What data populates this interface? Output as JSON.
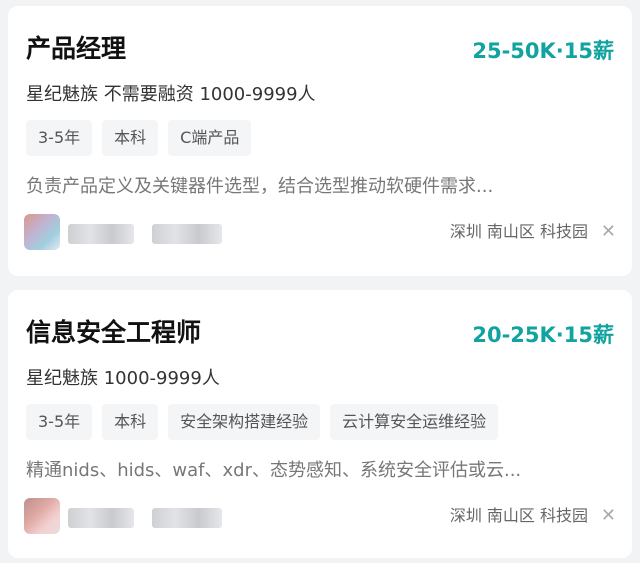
{
  "jobs": [
    {
      "title": "产品经理",
      "salary": "25-50K·15薪",
      "company": "星纪魅族 不需要融资 1000-9999人",
      "tags": [
        "3-5年",
        "本科",
        "C端产品"
      ],
      "description": "负责产品定义及关键器件选型，结合选型推动软硬件需求...",
      "location": "深圳 南山区 科技园",
      "close_symbol": "✕"
    },
    {
      "title": "信息安全工程师",
      "salary": "20-25K·15薪",
      "company": "星纪魅族 1000-9999人",
      "tags": [
        "3-5年",
        "本科",
        "安全架构搭建经验",
        "云计算安全运维经验"
      ],
      "description": "精通nids、hids、waf、xdr、态势感知、系统安全评估或云...",
      "location": "深圳 南山区 科技园",
      "close_symbol": "✕"
    }
  ],
  "colors": {
    "salary": "#11a3a0",
    "background": "#f2f3f5",
    "card": "#ffffff",
    "tag_bg": "#f4f5f7"
  },
  "icons": {
    "close": "close-icon",
    "avatar": "recruiter-avatar"
  }
}
